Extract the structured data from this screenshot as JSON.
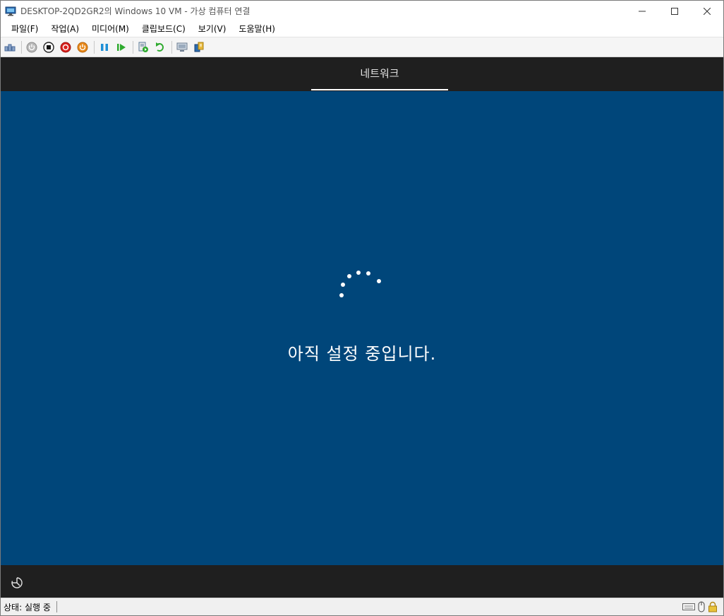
{
  "window": {
    "title": "DESKTOP-2QD2GR2의 Windows 10 VM - 가상 컴퓨터 연결"
  },
  "menu": {
    "items": [
      "파일(F)",
      "작업(A)",
      "미디어(M)",
      "클립보드(C)",
      "보기(V)",
      "도움말(H)"
    ]
  },
  "toolbar": {
    "icons": [
      "ctrl-alt-del-icon",
      "start-icon",
      "turn-off-icon",
      "shutdown-icon",
      "save-icon",
      "pause-icon",
      "reset-icon",
      "checkpoint-icon",
      "revert-icon",
      "enhanced-session-icon",
      "share-icon"
    ]
  },
  "vm": {
    "tab_label": "네트워크",
    "message": "아직 설정 중입니다.",
    "background_color": "#00467a"
  },
  "statusbar": {
    "status": "상태: 실행 중"
  }
}
